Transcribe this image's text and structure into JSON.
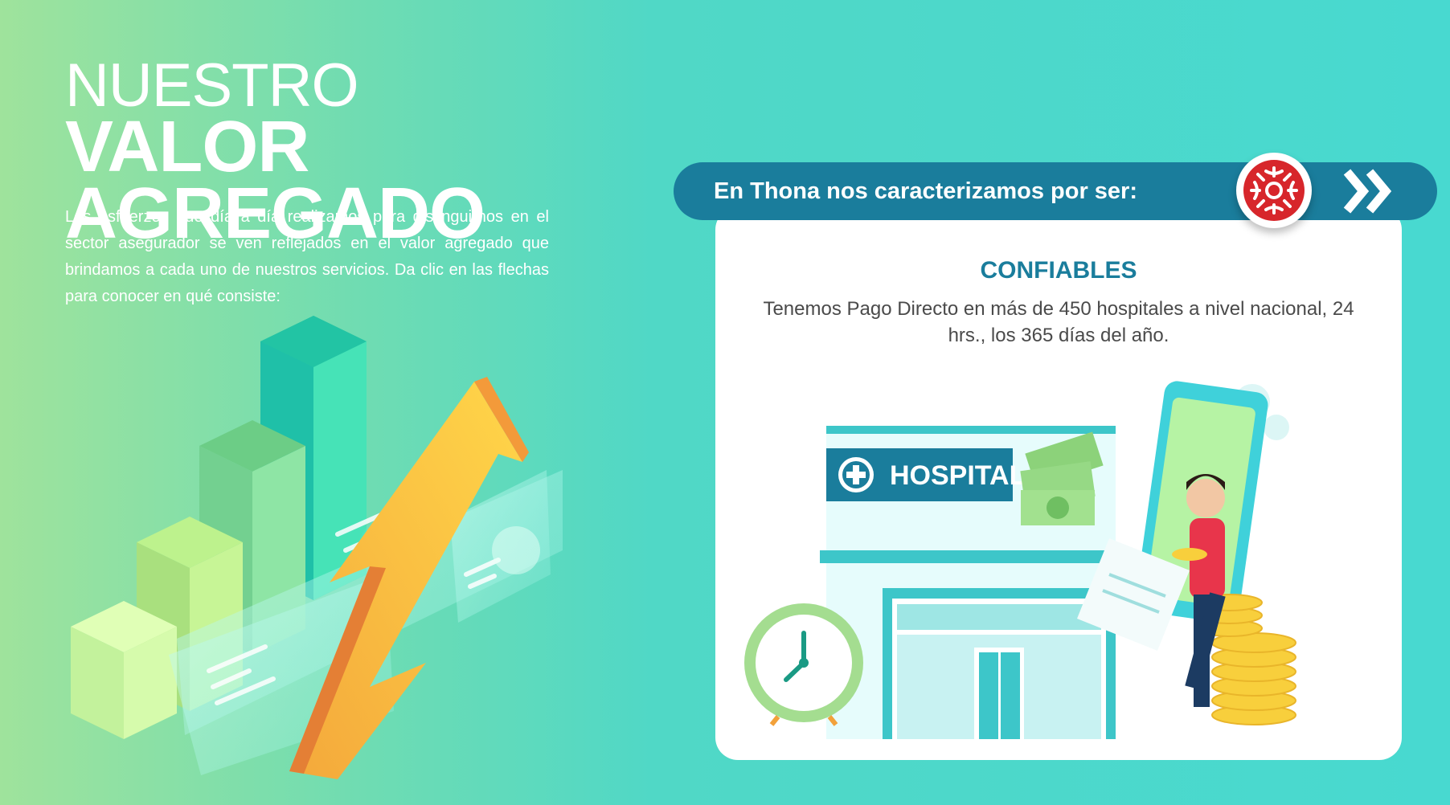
{
  "headline": {
    "light": "NUESTRO",
    "bold": "VALOR",
    "line2": "AGREGADO"
  },
  "intro_text": "Los esfuerzos que día a día realizamos para distinguirnos en el sector asegurador se ven reflejados en el valor agregado que brindamos a cada uno de nuestros servicios. Da clic en las flechas para conocer en qué consiste:",
  "banner": {
    "text": "En Thona nos caracterizamos por ser:",
    "logo_icon": "thona-logo-icon",
    "next_icon": "double-chevron-right-icon"
  },
  "value": {
    "title": "CONFIABLES",
    "description": "Tenemos Pago Directo en más de 450 hospitales a nivel nacional, 24 hrs., los 365 días del año."
  },
  "hospital_sign": "HOSPITAL",
  "colors": {
    "banner": "#1a7d9c",
    "title": "#1a7d9c",
    "logo_red": "#d7262b",
    "arrow_yellow": "#f8c63a"
  }
}
